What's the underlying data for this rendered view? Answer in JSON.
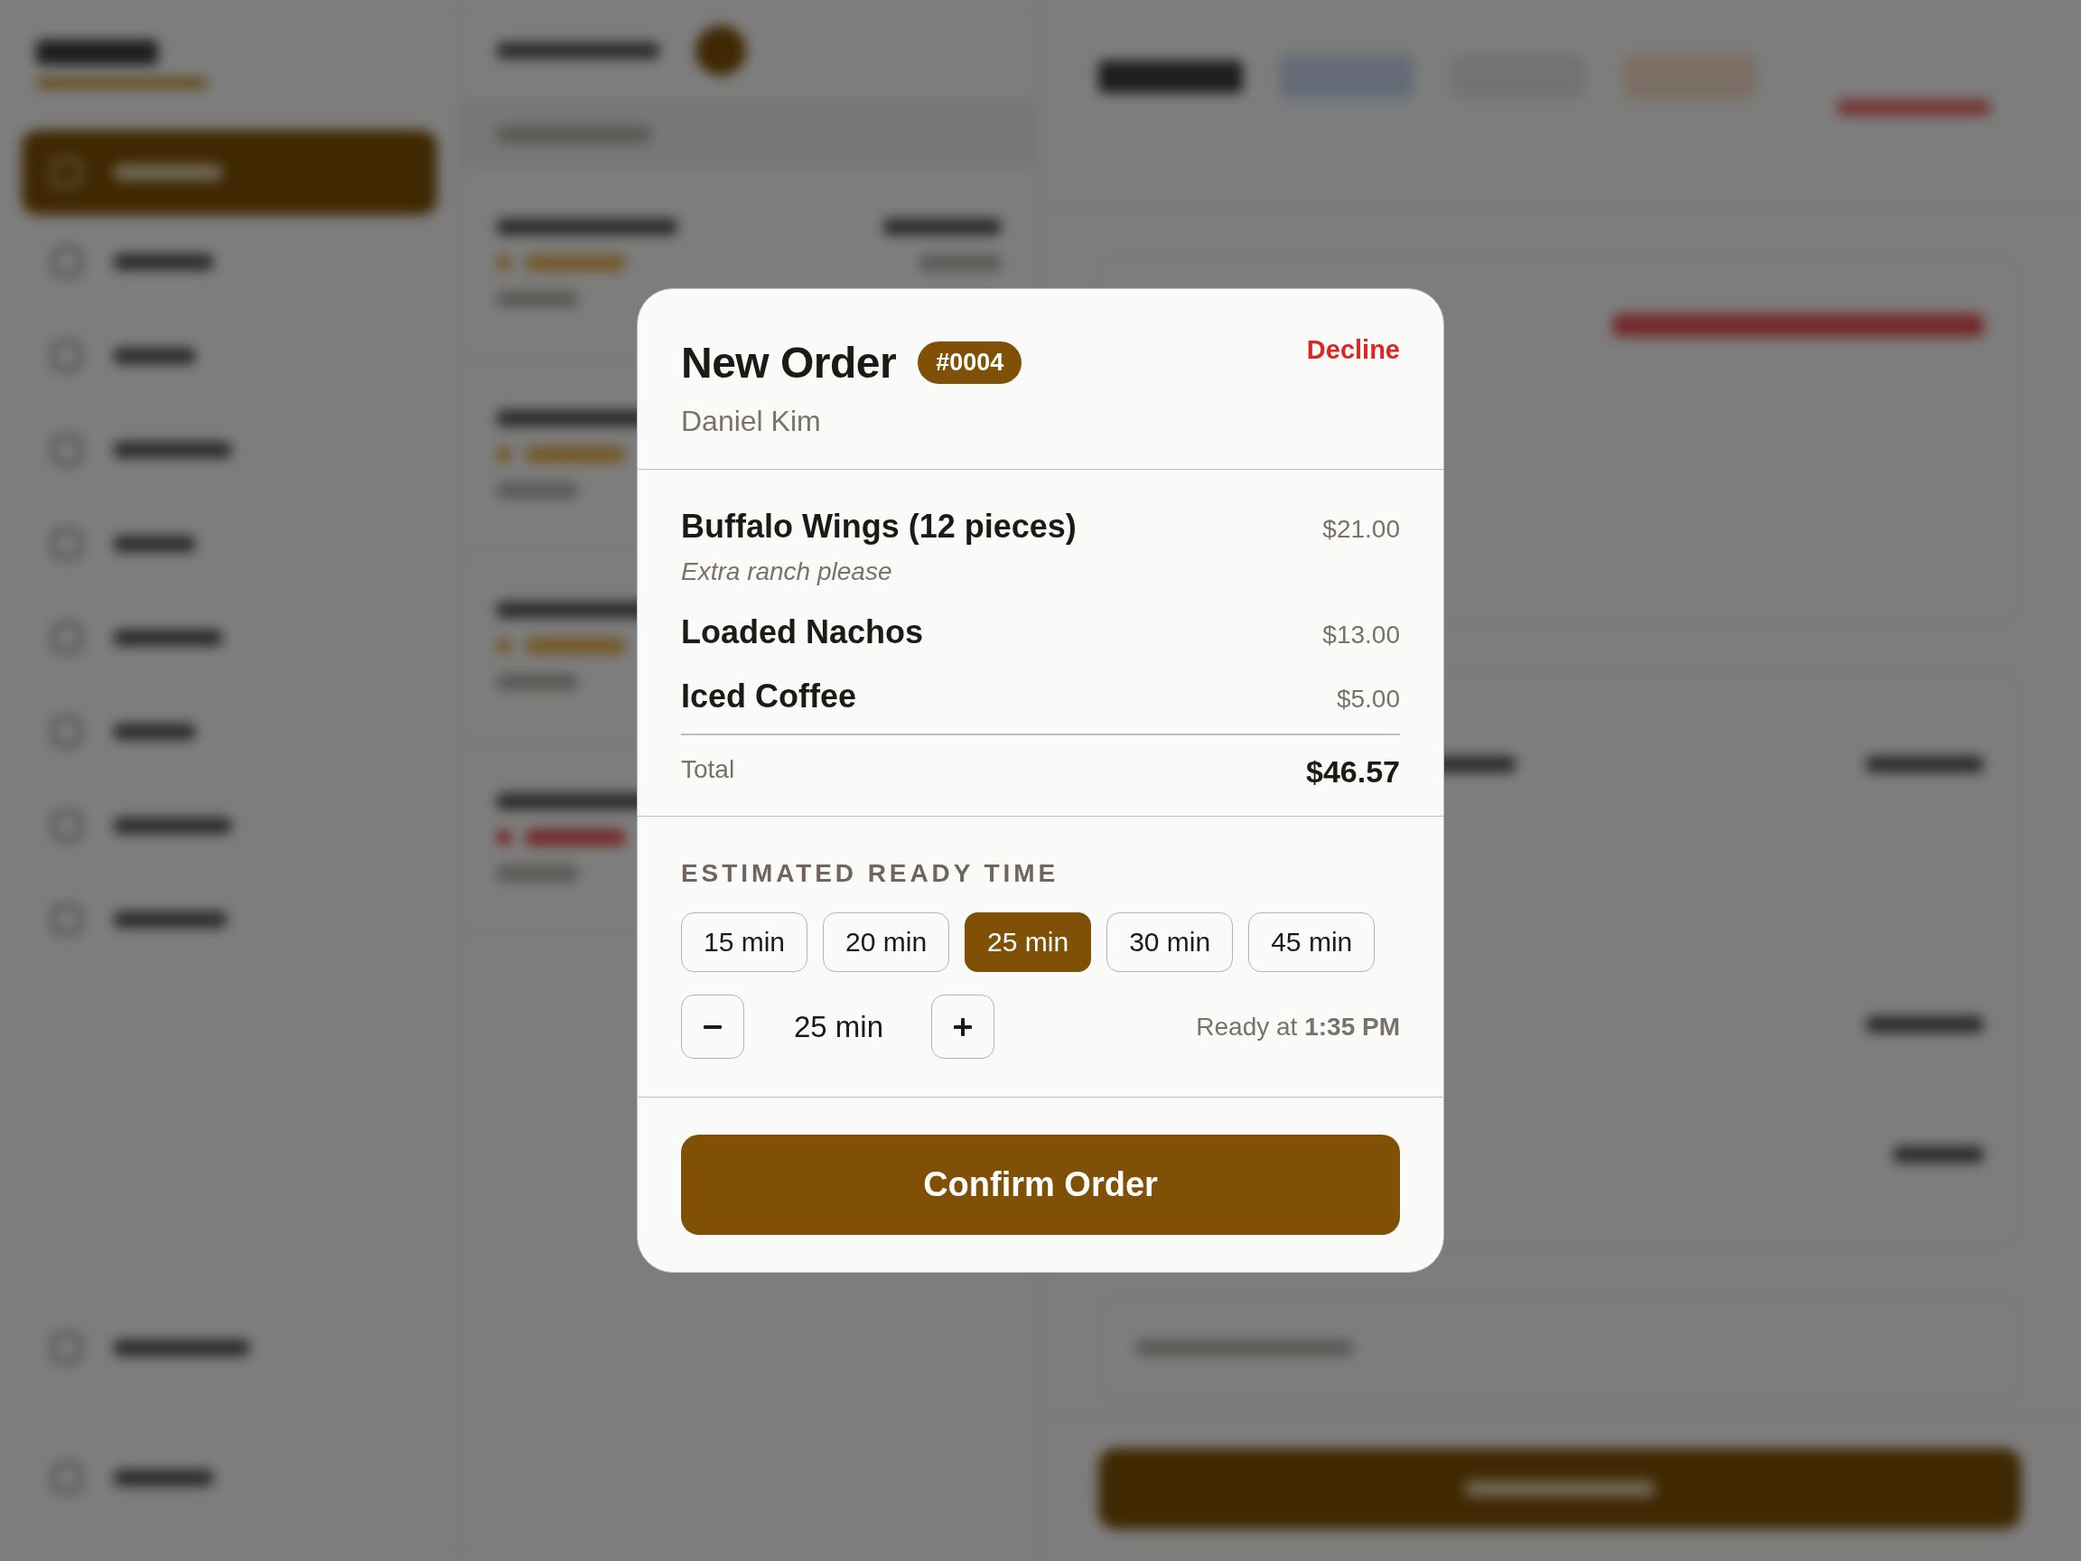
{
  "modal": {
    "title": "New Order",
    "order_number": "#0004",
    "customer": "Daniel Kim",
    "decline_label": "Decline"
  },
  "items": [
    {
      "name": "Buffalo Wings (12 pieces)",
      "price": "$21.00",
      "note": "Extra ranch please"
    },
    {
      "name": "Loaded Nachos",
      "price": "$13.00"
    },
    {
      "name": "Iced Coffee",
      "price": "$5.00"
    }
  ],
  "total": {
    "label": "Total",
    "value": "$46.57"
  },
  "ready_time": {
    "heading": "ESTIMATED READY TIME",
    "options": [
      {
        "label": "15 min",
        "selected": false
      },
      {
        "label": "20 min",
        "selected": false
      },
      {
        "label": "25 min",
        "selected": true
      },
      {
        "label": "30 min",
        "selected": false
      },
      {
        "label": "45 min",
        "selected": false
      }
    ],
    "stepper_value": "25 min",
    "ready_at": "Ready at **1:35 PM**"
  },
  "confirm_button": "Confirm Order"
}
